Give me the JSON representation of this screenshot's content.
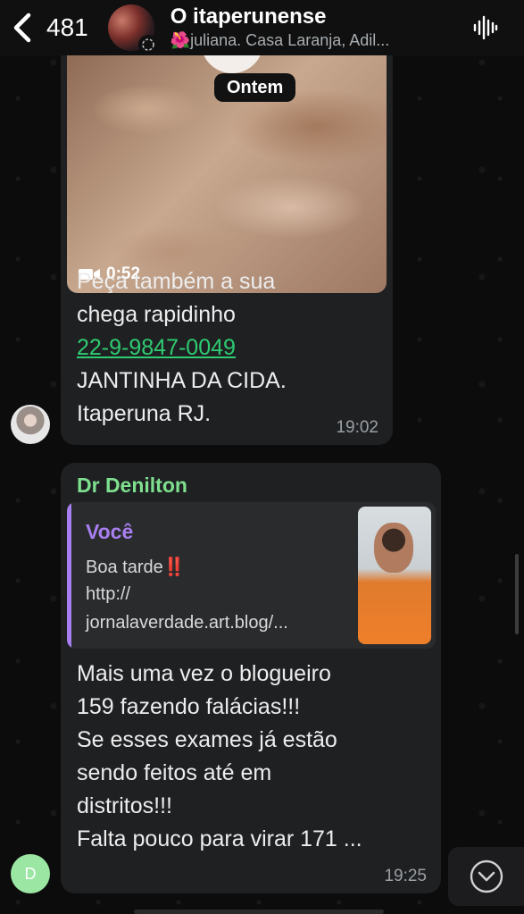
{
  "header": {
    "back_count": "481",
    "title": "O itaperunense",
    "subtitle": "🌺juliana. Casa Laranja, Adil..."
  },
  "date_separator": "Ontem",
  "messages": [
    {
      "video_duration": "0:52",
      "lines": [
        "Peça também a sua",
        "chega rapidinho"
      ],
      "phone": "22-9-9847-0049",
      "lines_after": [
        "JANTINHA DA CIDA.",
        "Itaperuna RJ."
      ],
      "time": "19:02"
    },
    {
      "sender": "Dr Denilton",
      "quote": {
        "author": "Você",
        "line1": "Boa tarde‼️",
        "line2": "http://",
        "line3": "jornalaverdade.art.blog/..."
      },
      "lines": [
        "Mais uma vez o blogueiro",
        "159 fazendo falácias!!!",
        "Se esses exames já estão",
        "sendo feitos até em",
        "distritos!!!",
        "Falta pouco para virar 171 ..."
      ],
      "time": "19:25",
      "avatar_initial": "D"
    }
  ],
  "colors": {
    "sender_name": "#7ee08f",
    "quote_accent": "#a77ff0",
    "link": "#2ecc71"
  }
}
